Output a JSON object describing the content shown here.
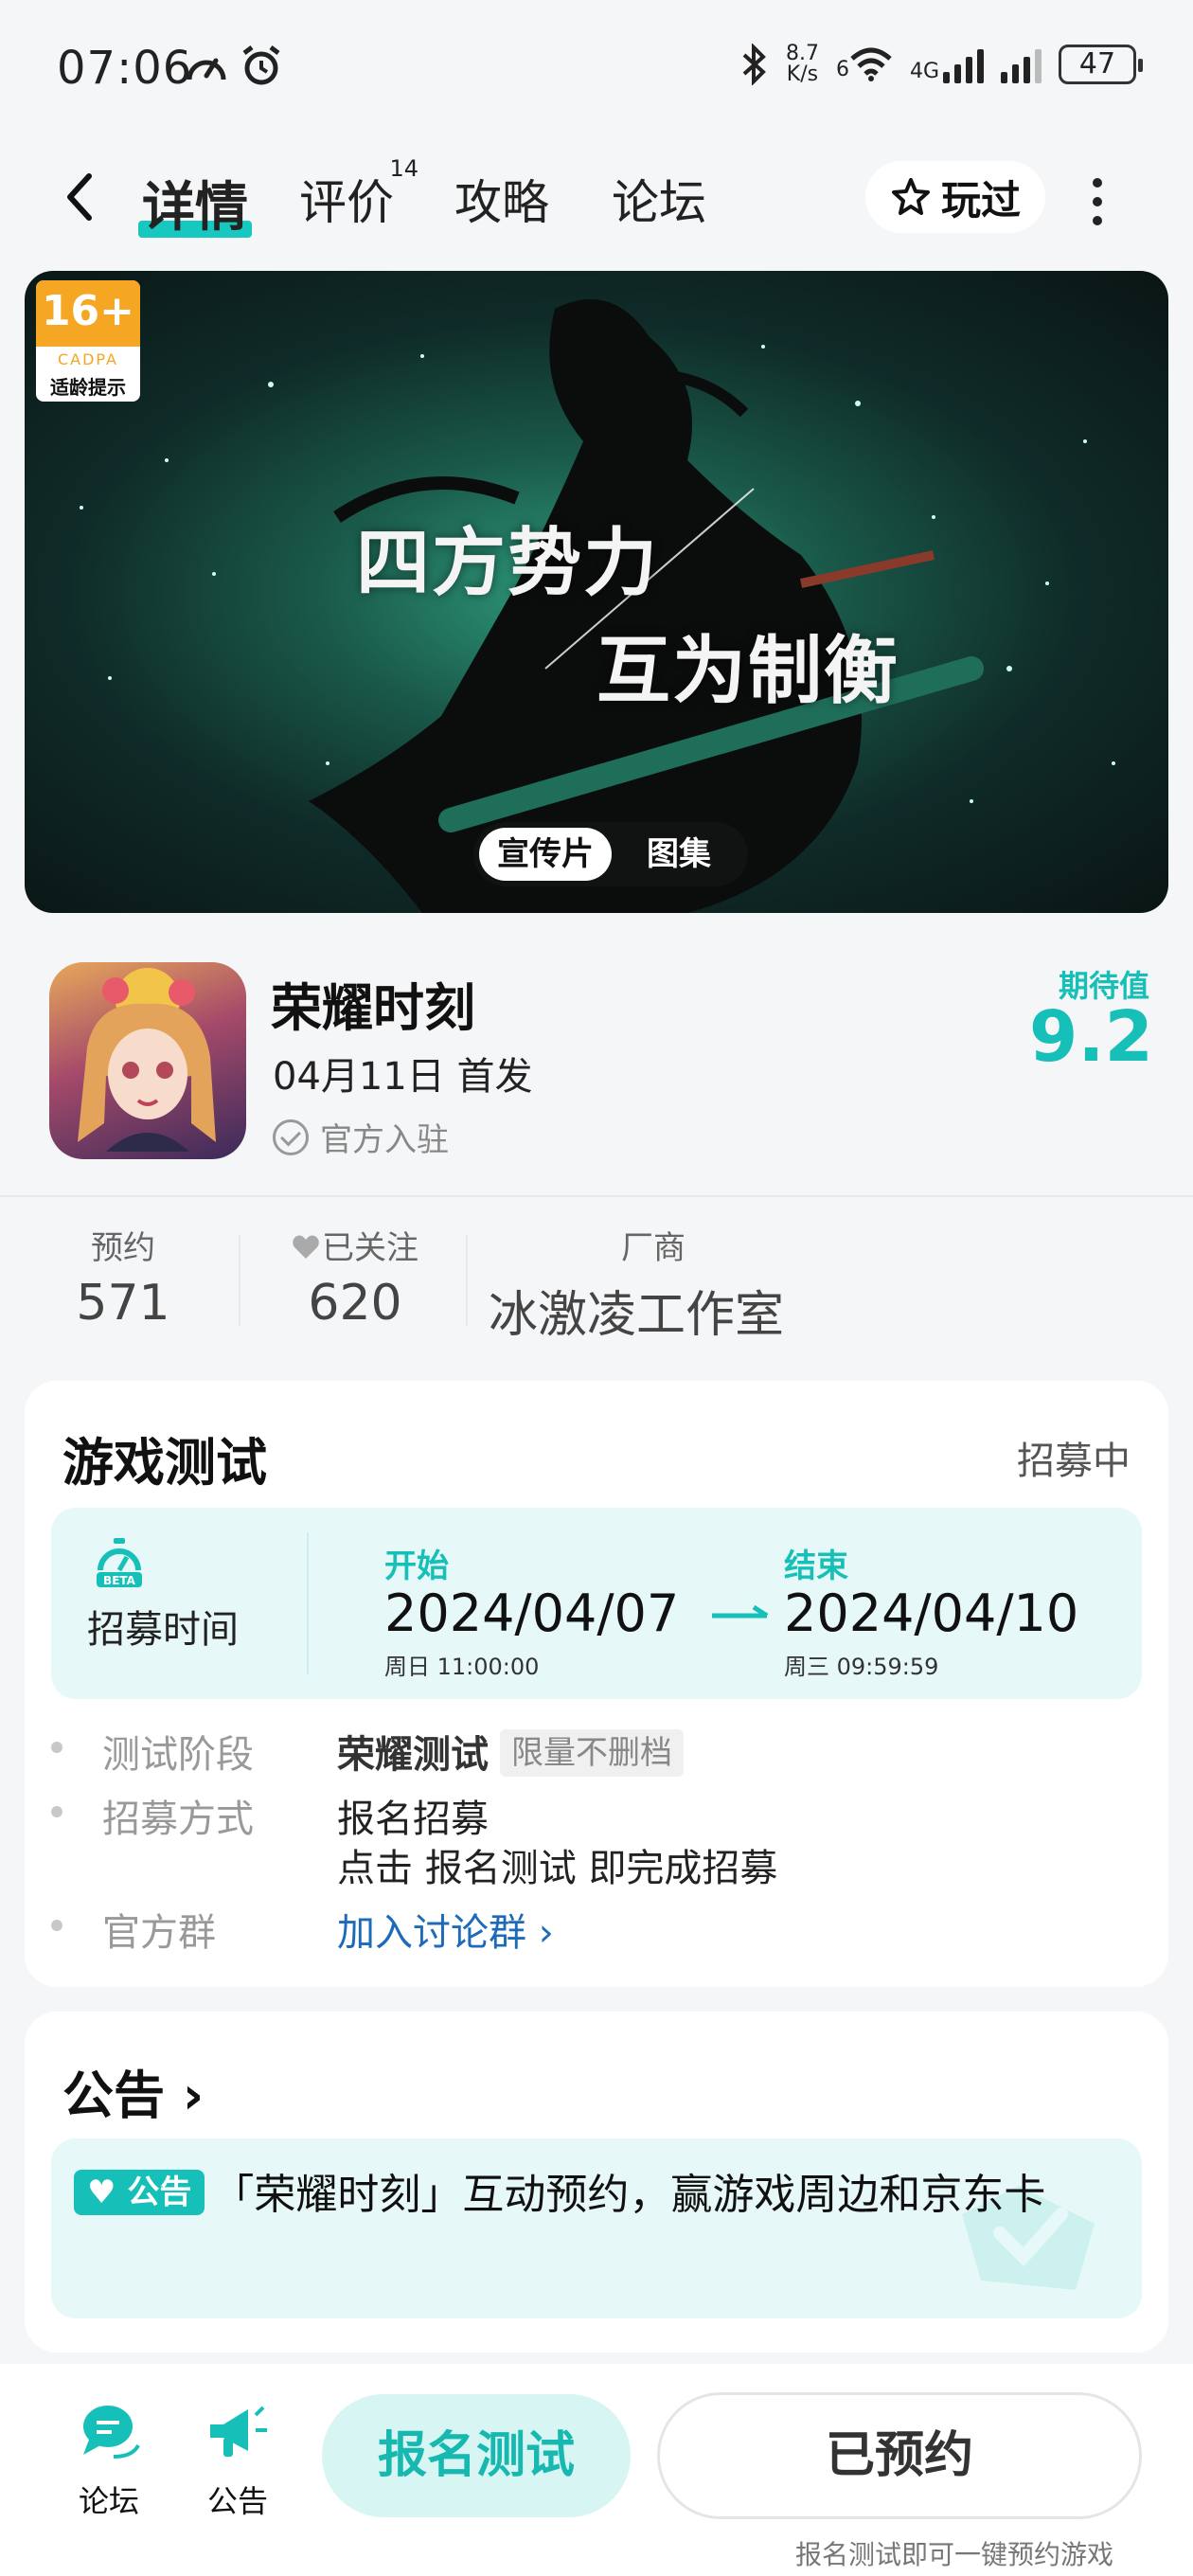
{
  "status_bar": {
    "time": "07:06",
    "speed_value": "8.7",
    "speed_unit": "K/s",
    "wifi_label": "6",
    "net_label": "4G",
    "battery": "47"
  },
  "nav": {
    "tabs": [
      {
        "label": "详情",
        "active": true
      },
      {
        "label": "评价",
        "badge": "14"
      },
      {
        "label": "攻略"
      },
      {
        "label": "论坛"
      }
    ],
    "played_label": "玩过"
  },
  "banner": {
    "age_rating": "16+",
    "age_org": "CADPA",
    "age_tip": "适龄提示",
    "slogan_line1": "四方势力",
    "slogan_line2": "互为制衡",
    "media_tabs": [
      "宣传片",
      "图集"
    ]
  },
  "game": {
    "title": "荣耀时刻",
    "release": "04月11日 首发",
    "official": "官方入驻",
    "expect_label": "期待值",
    "expect_value": "9.2"
  },
  "stats": {
    "reserve_label": "预约",
    "reserve_value": "571",
    "follow_label": "已关注",
    "follow_value": "620",
    "vendor_label": "厂商",
    "vendor_value": "冰激凌工作室"
  },
  "test": {
    "title": "游戏测试",
    "status": "招募中",
    "recruit_label": "招募时间",
    "start_label": "开始",
    "start_date": "2024/04/07",
    "start_sub": "周日  11:00:00",
    "end_label": "结束",
    "end_date": "2024/04/10",
    "end_sub": "周三  09:59:59",
    "phase_key": "测试阶段",
    "phase_value": "荣耀测试",
    "phase_tag": "限量不删档",
    "method_key": "招募方式",
    "method_value": "报名招募",
    "method_detail_pre": "点击",
    "method_detail_bold": "报名测试",
    "method_detail_post": "即完成招募",
    "group_key": "官方群",
    "group_link": "加入讨论群"
  },
  "notice": {
    "title": "公告",
    "tag": "公告",
    "text": "「荣耀时刻」互动预约，赢游戏周边和京东卡"
  },
  "bottom_bar": {
    "forum_label": "论坛",
    "notice_label": "公告",
    "apply_button": "报名测试",
    "reserved_button": "已预约",
    "hint": "报名测试即可一键预约游戏"
  },
  "colors": {
    "accent": "#16c0b8",
    "link": "#1d6bb8"
  }
}
